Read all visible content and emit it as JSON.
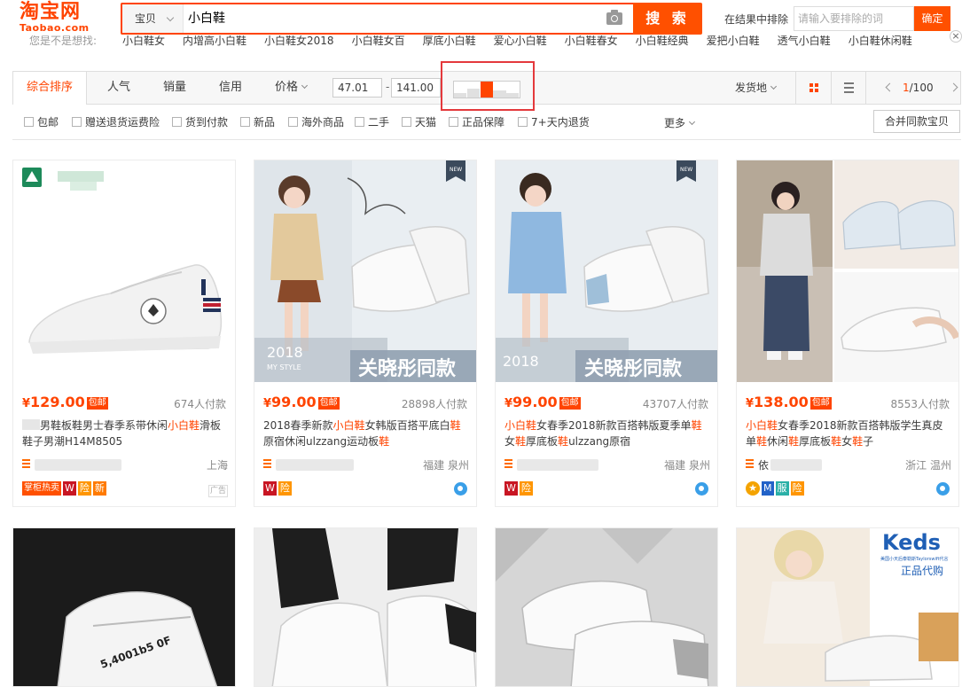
{
  "header": {
    "logo_cn": "淘宝网",
    "logo_en": "Taobao.com",
    "scope": "宝贝",
    "query": "小白鞋",
    "search_label": "搜 索",
    "exclude_label": "在结果中排除",
    "exclude_placeholder": "请输入要排除的词",
    "exclude_btn": "确定"
  },
  "suggest": {
    "prefix": "您是不是想找:",
    "items": [
      "小白鞋女",
      "内增高小白鞋",
      "小白鞋女2018",
      "小白鞋女百",
      "厚底小白鞋",
      "爱心小白鞋",
      "小白鞋春女",
      "小白鞋经典",
      "爱把小白鞋",
      "透气小白鞋",
      "小白鞋休闲鞋"
    ]
  },
  "sortbar": {
    "tabs": [
      "综合排序",
      "人气",
      "销量",
      "信用",
      "价格"
    ],
    "price_min": "47.01",
    "price_max": "141.00",
    "price_dash": "-",
    "ship_from": "发货地",
    "page_current": "1",
    "page_total": "/100",
    "histogram_levels": [
      0.3,
      0.55,
      1.0,
      0.45,
      0.25
    ]
  },
  "filters": {
    "items": [
      "包邮",
      "赠送退货运费险",
      "货到付款",
      "新品",
      "海外商品",
      "二手",
      "天猫",
      "正品保障",
      "7+天内退货"
    ],
    "more": "更多",
    "merge": "合并同款宝贝"
  },
  "products": [
    {
      "price": "129.00",
      "free": "包邮",
      "sales": "674人付款",
      "title_parts": [
        "",
        "男鞋板鞋男士春季系带休闲",
        "小白鞋",
        "滑板鞋子男潮H14M8505"
      ],
      "location": "上海",
      "badges": [
        {
          "text": "掌柜热卖",
          "color": "#ff5000"
        },
        {
          "text": "W",
          "color": "#c81623"
        },
        {
          "text": "险",
          "color": "#ff9500"
        },
        {
          "text": "新",
          "color": "#ff7a00"
        }
      ],
      "ad": "广告",
      "new_tag": ""
    },
    {
      "price": "99.00",
      "free": "包邮",
      "sales": "28898人付款",
      "title_parts": [
        "2018春季新款",
        "小白鞋",
        "女韩版百搭平底白",
        "鞋",
        "原宿休闲ulzzang运动板",
        "鞋"
      ],
      "shop": "",
      "location": "福建 泉州",
      "badges": [
        {
          "text": "W",
          "color": "#c81623"
        },
        {
          "text": "险",
          "color": "#ff9500"
        }
      ],
      "new_tag": "NEW",
      "banner": "关晓彤同款",
      "year": "2018",
      "style": "MY STYLE"
    },
    {
      "price": "99.00",
      "free": "包邮",
      "sales": "43707人付款",
      "title_parts": [
        "",
        "小白鞋",
        "女春季2018新款百搭韩版夏季单",
        "鞋",
        "女",
        "鞋",
        "厚底板",
        "鞋",
        "ulzzang原宿"
      ],
      "location": "福建 泉州",
      "badges": [
        {
          "text": "W",
          "color": "#c81623"
        },
        {
          "text": "险",
          "color": "#ff9500"
        }
      ],
      "new_tag": "NEW",
      "banner": "关晓彤同款",
      "year": "2018"
    },
    {
      "price": "138.00",
      "free": "包邮",
      "sales": "8553人付款",
      "title_parts": [
        "",
        "小白鞋",
        "女春季2018新款百搭韩版学生真皮单",
        "鞋",
        "休闲",
        "鞋",
        "厚底板",
        "鞋",
        "女",
        "鞋",
        "子"
      ],
      "shop_initial": "依",
      "location": "浙江 温州",
      "badges": [
        {
          "text": "★",
          "color": "#f4a300"
        },
        {
          "text": "M",
          "color": "#2262c8"
        },
        {
          "text": "服",
          "color": "#2ab0a7"
        },
        {
          "text": "险",
          "color": "#ff9500"
        }
      ],
      "new_tag": ""
    }
  ],
  "row2": {
    "keds_brand": "Keds",
    "keds_note": "美国小天后泰勒斯Taylorswift代言",
    "keds_tag": "正品代购",
    "shoe_print": "5,4001b5 0F"
  },
  "colors": {
    "accent": "#ff4400",
    "highlight_border": "#e4393c"
  }
}
